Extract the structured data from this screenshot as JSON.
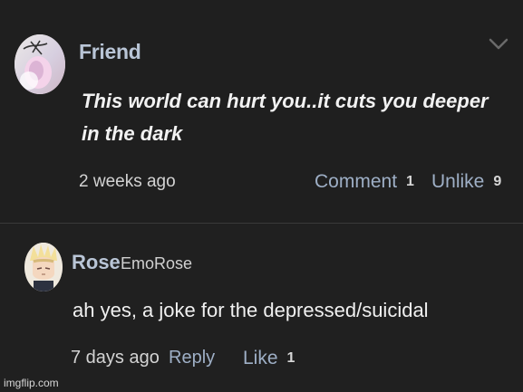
{
  "post": {
    "author": "Friend",
    "body": "This world can hurt you..it cuts you deeper in the dark",
    "time": "2 weeks ago",
    "comment_label": "Comment",
    "comment_count": "1",
    "unlike_label": "Unlike",
    "unlike_count": "9",
    "chevron_icon": "chevron-down-icon"
  },
  "reply": {
    "author": "Rose",
    "handle": "EmoRose",
    "body": "ah yes, a joke for the depressed/suicidal",
    "time": "7 days ago",
    "reply_label": "Reply",
    "like_label": "Like",
    "like_count": "1"
  },
  "watermark": "imgflip.com",
  "colors": {
    "background": "#202020",
    "name": "#b9c5d6",
    "action": "#9eafc6",
    "text": "#f2f2f2"
  }
}
